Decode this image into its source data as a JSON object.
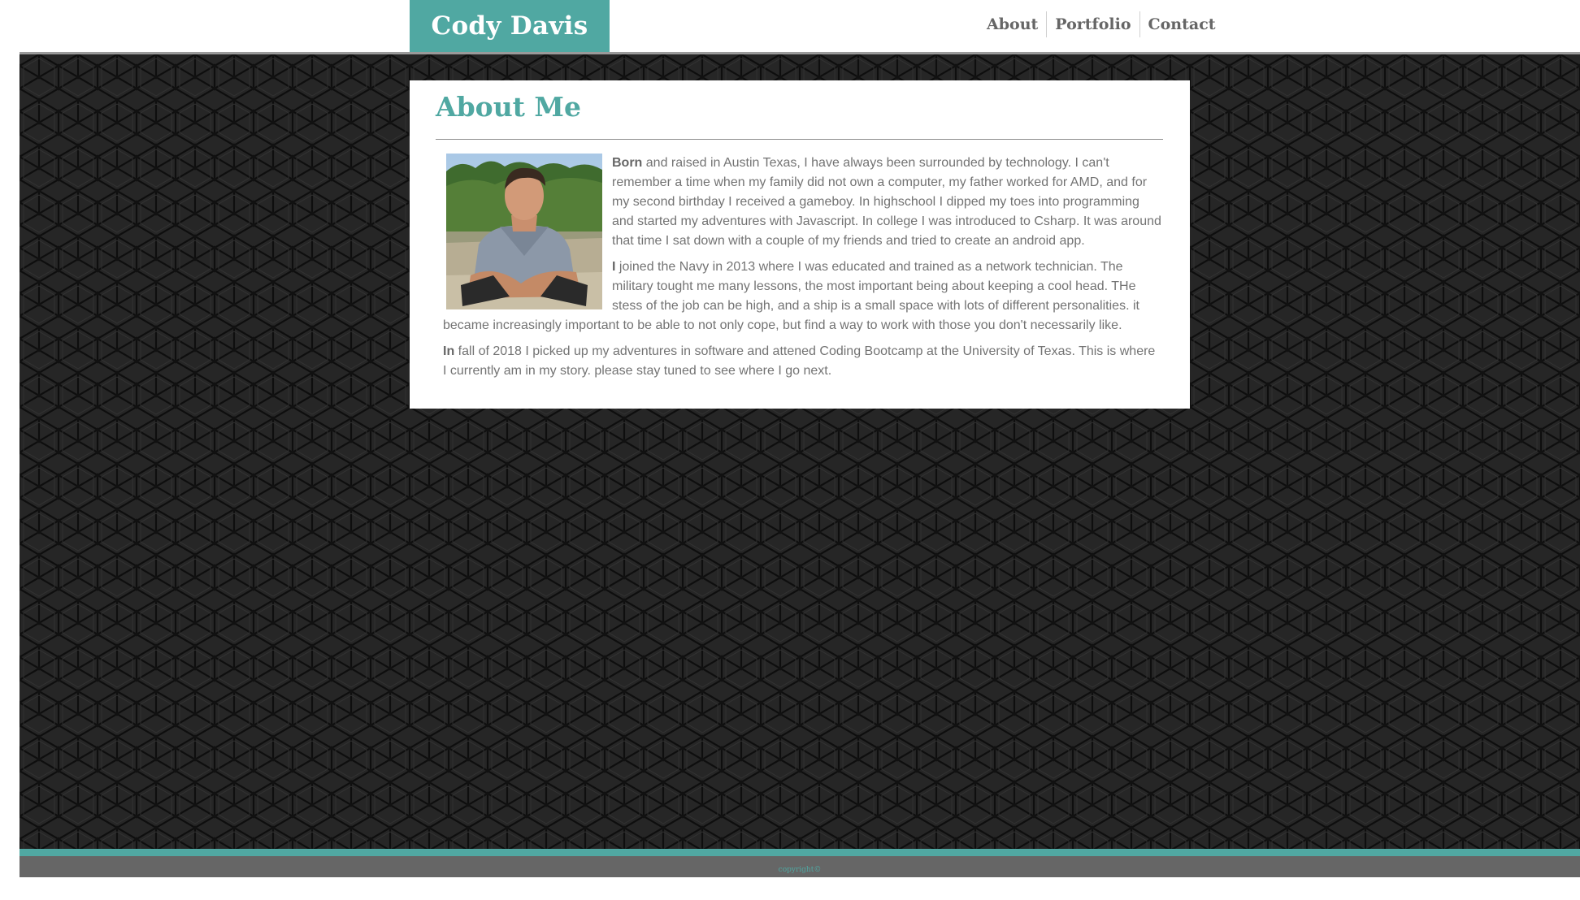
{
  "header": {
    "brand": "Cody Davis",
    "nav": [
      "About",
      "Portfolio",
      "Contact"
    ]
  },
  "about": {
    "title": "About Me",
    "paragraphs": [
      {
        "lead": "Born",
        "text": " and raised in Austin Texas, I have always been surrounded by technology. I can't remember a time when my family did not own a computer, my father worked for AMD, and for my second birthday I received a gameboy. In highschool I dipped my toes into programming and started my adventures with Javascript. In college I was introduced to Csharp. It was around that time I sat down with a couple of my friends and tried to create an android app."
      },
      {
        "lead": "I",
        "text": " joined the Navy in 2013 where I was educated and trained as a network technician. The military tought me many lessons, the most important being about keeping a cool head. THe stess of the job can be high, and a ship is a small space with lots of different personalities. it became increasingly important to be able to not only cope, but find a way to work with those you don't necessarily like."
      },
      {
        "lead": "In",
        "text": " fall of 2018 I picked up my adventures in software and attened Coding Bootcamp at the University of Texas. This is where I currently am in my story. please stay tuned to see where I go next."
      }
    ]
  },
  "footer": {
    "copyright": "copyright©"
  },
  "colors": {
    "accent": "#50a8a2",
    "background": "#262626",
    "text": "#737373",
    "footer": "#666666"
  }
}
